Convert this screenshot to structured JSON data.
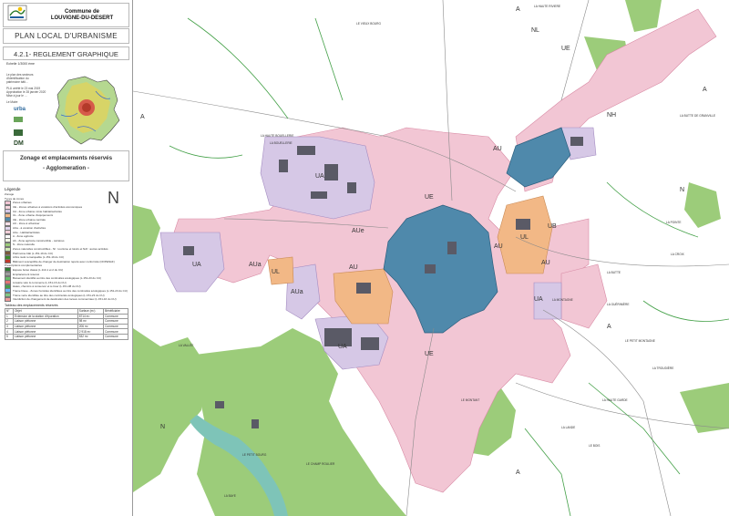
{
  "header": {
    "commune_label": "Commune de",
    "commune_name": "LOUVIGNE-DU-DESERT",
    "plu_title": "PLAN LOCAL D'URBANISME",
    "doc_title": "4.2.1- REGLEMENT GRAPHIQUE",
    "scale": "Echelle 1/3000 ème",
    "note_lines": [
      "Le plan des secteurs",
      "d'identification du",
      "patrimoine bâti…",
      "PLU arrêté le 23 mai 2019",
      "Approbation le 28 janvier 2020",
      "Mise à jour le …",
      "Le Maire"
    ],
    "zonage_title": "Zonage et emplacements réservés",
    "zonage_subtitle": "- Agglomeration -"
  },
  "partner_logos": [
    "urba",
    "DM"
  ],
  "legend": {
    "title": "Légende",
    "entries": [
      {
        "label": "Zonage",
        "color": ""
      },
      {
        "label": "Types de zones",
        "color": ""
      },
      {
        "label": "Zones urbaines",
        "color": "#f2c6d4"
      },
      {
        "label": "UE - Zones urbaines à vocations d'activités économiques",
        "color": "#f7d7e0"
      },
      {
        "label": "UA - Zone urbaine mixte habitat/activités",
        "color": "#d6c8e6"
      },
      {
        "label": "UL - Zone urbaine d'équipements",
        "color": "#f2b886"
      },
      {
        "label": "UE - Zone urbaine centrale",
        "color": "#4f89ab"
      },
      {
        "label": "AU - Zone à urbaniser",
        "color": "#f7e0e8"
      },
      {
        "label": "AUa - à vocation d'activités",
        "color": "#e2d6ee"
      },
      {
        "label": "AUe - Habitat/activités",
        "color": "#f3cfd8"
      },
      {
        "label": "A - Zone agricole",
        "color": "#ffffff"
      },
      {
        "label": "Ab - Zone agricole constructible - carrières",
        "color": "#f2f5e6"
      },
      {
        "label": "N - Zone naturelle",
        "color": "#9ccc7a"
      },
      {
        "label": "Zones naturelles constructibles - NI : tourisme et loisirs et NAf : autres activités",
        "color": "#cfe8b5"
      },
      {
        "label": "Patrimoine bâti (L.151-19 du CU)",
        "color": "#7a5a3a"
      },
      {
        "label": "Arbre isolé remarquable (L.151-19 du CU)",
        "color": "#3a8a2a"
      },
      {
        "label": "Bâtiment susceptible de changer de destination repéré avec conformité (CDPENAF)",
        "color": "#c0392b"
      },
      {
        "label": "Prescriptions complémentaires",
        "color": ""
      },
      {
        "label": "Espace boisé classé (L.113-1 et 2 du CU)",
        "color": "#2e7d32"
      },
      {
        "label": "Emplacement réservé",
        "color": "#9e9e9e"
      },
      {
        "label": "Boisement identifié au titre des continuités écologiques (L.151-23 du CU)",
        "color": "#66bb6a"
      },
      {
        "label": "Linéaire vélo & commerce (L.151-16 du CU)",
        "color": "#e57373"
      },
      {
        "label": "Haies, chemins à conserver et à créer (L.151-38 du CU)",
        "color": "#43a047"
      },
      {
        "label": "Trame bleue - Zones humides identifiées au titre des continuités écologiques (L.151-23 du CU)",
        "color": "#64b5f6"
      },
      {
        "label": "Trame verte identifiée au titre des continuités écologiques (L.151-23 du CU)",
        "color": "#81c784"
      },
      {
        "label": "Interdiction de changement de destination des locaux commerciaux (L.151-16 du CU)",
        "color": "#ef9a9a"
      }
    ]
  },
  "reserved_table": {
    "title": "Tableau des emplacements réservés",
    "headers": [
      "N°",
      "Objet",
      "Surface (m²)",
      "Bénéficiaire"
    ],
    "rows": [
      [
        "1",
        "Extension de la station d'épuration",
        "8714 m²",
        "Commune"
      ],
      [
        "2",
        "Liaison piétonne",
        "98 m²",
        "Commune"
      ],
      [
        "3",
        "Liaison piétonne",
        "206 m²",
        "Commune"
      ],
      [
        "4",
        "Liaison piétonne",
        "2 918 m²",
        "Commune"
      ],
      [
        "5",
        "Liaison piétonne",
        "532 m²",
        "Commune"
      ]
    ]
  },
  "map_labels": {
    "north": "N",
    "zone_codes": [
      "A",
      "UE",
      "UA",
      "AU",
      "UL",
      "AUa",
      "AUe",
      "UB",
      "N",
      "NL",
      "NH"
    ],
    "places": [
      "LE VIEUX BOURG",
      "LA MONTAGNE",
      "LA BUTTE",
      "LA HAUTE BOUELLERIE",
      "LA BOUELLERIE",
      "LE CHAMP ROULIER",
      "LA GUÉRINIÈRE",
      "LE PETIT MONTAGNE",
      "LA HAUTE GARDE",
      "LE PETIT BOURG",
      "LA BAYE",
      "LA POINTE",
      "LA CROIX",
      "LA VALLÉE",
      "LA HAUTE RIVIERE",
      "LA BUTTE DE GRANVILLE",
      "LE BOIS",
      "LA TROUDIÈRE",
      "LA LANDE",
      "LE MONTANT"
    ]
  },
  "colors": {
    "zone_ue": "#f2c6d4",
    "zone_ua": "#d6c8e6",
    "zone_ul": "#f2b886",
    "zone_centre": "#4f89ab",
    "zone_n": "#9ccc7a",
    "zone_a": "#ffffff",
    "water": "#7ec4b8",
    "building": "#5a5a66"
  }
}
